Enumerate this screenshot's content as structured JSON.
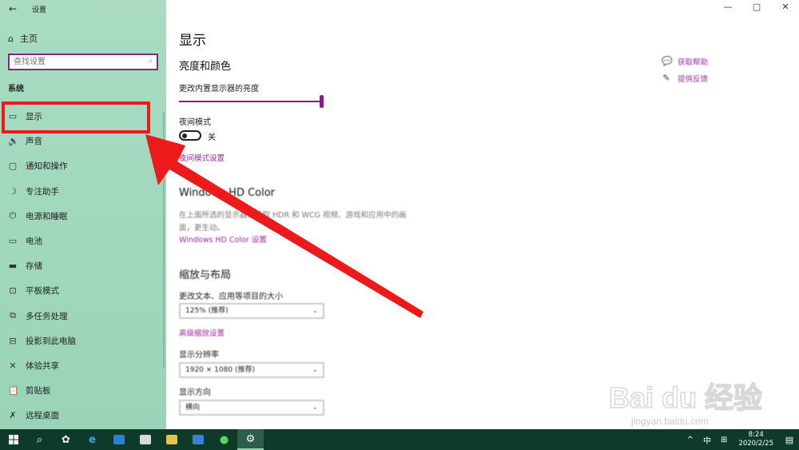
{
  "window": {
    "title": "设置",
    "controls": {
      "minimize": "—",
      "maximize": "▢",
      "close": "✕"
    }
  },
  "sidebar": {
    "back_icon": "←",
    "home_label": "主页",
    "search_placeholder": "查找设置",
    "section": "系统",
    "items": [
      {
        "icon": "▭",
        "label": "显示"
      },
      {
        "icon": "🔈",
        "label": "声音"
      },
      {
        "icon": "▢",
        "label": "通知和操作"
      },
      {
        "icon": "☽",
        "label": "专注助手"
      },
      {
        "icon": "⏻",
        "label": "电源和睡眠"
      },
      {
        "icon": "▭",
        "label": "电池"
      },
      {
        "icon": "▬",
        "label": "存储"
      },
      {
        "icon": "⊡",
        "label": "平板模式"
      },
      {
        "icon": "⧉",
        "label": "多任务处理"
      },
      {
        "icon": "⊟",
        "label": "投影到此电脑"
      },
      {
        "icon": "✕",
        "label": "体验共享"
      },
      {
        "icon": "📋",
        "label": "剪贴板"
      },
      {
        "icon": "✗",
        "label": "远程桌面"
      }
    ]
  },
  "main": {
    "title": "显示",
    "brightness_section": "亮度和颜色",
    "brightness_label": "更改内置显示器的亮度",
    "brightness_value": 1.0,
    "night_mode_label": "夜间模式",
    "night_mode_state": "关",
    "night_mode_link": "夜间模式设置",
    "hdr_section": "Windows HD Color",
    "hdr_desc": "在上面所选的显示器上获取 HDR 和 WCG 视频、游戏和应用中的画面，更生动。",
    "hdr_link": "Windows HD Color 设置",
    "scale_section": "缩放与布局",
    "scale_label": "更改文本、应用等项目的大小",
    "scale_value": "125% (推荐)",
    "scale_link": "高级缩放设置",
    "resolution_label": "显示分辨率",
    "resolution_value": "1920 × 1080 (推荐)",
    "orientation_label": "显示方向",
    "orientation_value": "横向"
  },
  "help": {
    "get_help": "获取帮助",
    "feedback": "提供反馈"
  },
  "watermark": {
    "brand": "Bai du 经验",
    "url": "jingyan.baidu.com"
  },
  "taskbar": {
    "tray": {
      "chevron": "^",
      "ime": "中",
      "kbd": "⊞"
    },
    "time": "8:24",
    "date": "2020/2/25"
  },
  "colors": {
    "accent": "#8b1a8b",
    "highlight": "#ec1a1a",
    "sidebar_bg": "#a9dcc2",
    "taskbar_bg": "#0e3a2a"
  }
}
